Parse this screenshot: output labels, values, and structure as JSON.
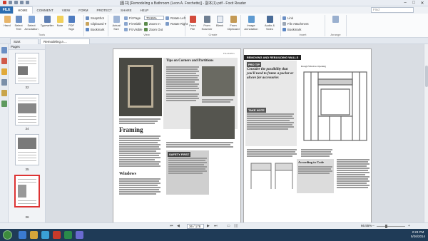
{
  "window": {
    "title": "[图书] [Remodeling a Bathroom (Leon A. Frechette)] - 副本(1).pdf - Foxit Reader",
    "minimize": "–",
    "maximize": "□",
    "close": "✕"
  },
  "menu": {
    "file": "FILE",
    "items": [
      "HOME",
      "COMMENT",
      "VIEW",
      "FORM",
      "PROTECT",
      "SHARE",
      "HELP"
    ],
    "active": "HOME",
    "find_placeholder": "Find"
  },
  "ribbon": {
    "tools": {
      "hand": "Hand",
      "select_text": "Select Text",
      "select_annotation": "Select Annotation",
      "typewriter": "Typewriter",
      "note": "Note",
      "pdf_sign": "PDF Sign",
      "snapshot": "SnapShot",
      "clipboard": "Clipboard ▾",
      "bookmark": "Bookmark"
    },
    "tools_group": "Tools",
    "view": {
      "actual_size": "Actual Size",
      "fit_page": "Fit Page",
      "fit_width": "Fit Width",
      "fit_visible": "Fit Visible",
      "zoom_value": "70.55%",
      "zoom_in": "Zoom In",
      "zoom_out": "Zoom Out",
      "rotate_left": "Rotate Left",
      "rotate_right": "Rotate Right"
    },
    "view_group": "View",
    "create": {
      "from_file": "From File",
      "from_scanner": "From Scanner",
      "blank": "Blank",
      "from_clipboard": "From Clipboard"
    },
    "create_group": "Create",
    "insert": {
      "image_annotation": "Image Annotation",
      "audio_video": "Audio & Video",
      "file_attachment": "File Attachment",
      "link": "Link",
      "bookmark": "Bookmark"
    },
    "insert_group": "Insert",
    "arrange_group": "Arrange"
  },
  "tabs": {
    "start": "Start",
    "doc": "Remodeling a ..."
  },
  "pages_panel": {
    "header": "Pages",
    "thumbs": [
      {
        "label": "32"
      },
      {
        "label": "34"
      },
      {
        "label": "35"
      },
      {
        "label": "36"
      }
    ]
  },
  "document": {
    "left_page": {
      "section_label": "FRAMING",
      "box_title": "Tips on Corners and Partitions",
      "heading_framing": "Framing",
      "heading_windows": "Windows",
      "safety_title": "SAFETY FIRST"
    },
    "right_page": {
      "banner": "REMOVING AND REBUILDING WALLS",
      "pro_tip_title": "PRO TIP",
      "pro_tip_text": "Consider the possibility that you'll need to frame a pocket or alcove for accessories",
      "take_note": "TAKE NOTE",
      "diagram_title": "Rough Window Opening",
      "code_title": "According to Code"
    }
  },
  "status": {
    "page_value": "36 / 178",
    "zoom_pct": "66.55%"
  },
  "taskbar": {
    "time": "2:23 PM",
    "date": "5/26/2014"
  }
}
